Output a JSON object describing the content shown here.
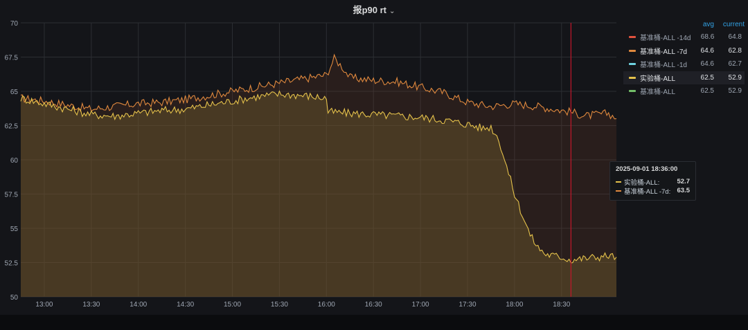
{
  "panel": {
    "title": "报p90 rt"
  },
  "tooltip": {
    "time": "2025-09-01 18:36:00",
    "rows": [
      {
        "name": "实验桶-ALL:",
        "value": "52.7",
        "color": "#e5c24b"
      },
      {
        "name": "基准桶-ALL -7d:",
        "value": "63.5",
        "color": "#e0893e"
      }
    ]
  },
  "legend": {
    "avg_header": "avg",
    "current_header": "current",
    "items": [
      {
        "name": "基准桶-ALL -14d",
        "avg": "68.6",
        "current": "64.8",
        "color": "#e0523e",
        "bold": false
      },
      {
        "name": "基准桶-ALL -7d",
        "avg": "64.6",
        "current": "62.8",
        "color": "#e0893e",
        "bold": true
      },
      {
        "name": "基准桶-ALL -1d",
        "avg": "64.6",
        "current": "62.7",
        "color": "#6fd3e0",
        "bold": false
      },
      {
        "name": "实验桶-ALL",
        "avg": "62.5",
        "current": "52.9",
        "color": "#e5c24b",
        "bold": true
      },
      {
        "name": "基准桶-ALL",
        "avg": "62.5",
        "current": "52.9",
        "color": "#73bf69",
        "bold": false
      }
    ]
  },
  "chart_data": {
    "type": "line",
    "title": "报p90 rt",
    "ylim": [
      50,
      70
    ],
    "yticks": [
      "50",
      "52.5",
      "55",
      "57.5",
      "60",
      "62.5",
      "65",
      "67.5",
      "70"
    ],
    "xlim": [
      "12:45",
      "19:05"
    ],
    "xticks": [
      "13:00",
      "13:30",
      "14:00",
      "14:30",
      "15:00",
      "15:30",
      "16:00",
      "16:30",
      "17:00",
      "17:30",
      "18:00",
      "18:30"
    ],
    "grid": true,
    "legend_position": "right",
    "cursor_time": "18:36",
    "series": [
      {
        "name": "基准桶-ALL -7d",
        "color": "#e0893e",
        "x": [
          "12:45",
          "13:00",
          "13:15",
          "13:30",
          "13:45",
          "14:00",
          "14:15",
          "14:30",
          "14:45",
          "15:00",
          "15:15",
          "15:30",
          "15:45",
          "16:00",
          "16:05",
          "16:10",
          "16:15",
          "16:30",
          "16:45",
          "17:00",
          "17:15",
          "17:30",
          "17:45",
          "18:00",
          "18:15",
          "18:30",
          "18:36",
          "18:45",
          "19:00",
          "19:05"
        ],
        "y": [
          64.5,
          64.3,
          64.0,
          63.7,
          63.9,
          64.1,
          64.2,
          64.4,
          64.7,
          65.0,
          65.3,
          65.6,
          65.9,
          66.2,
          67.4,
          66.8,
          66.0,
          65.8,
          65.7,
          65.3,
          64.9,
          64.2,
          63.9,
          64.1,
          63.9,
          63.6,
          63.5,
          63.2,
          63.4,
          63.0
        ]
      },
      {
        "name": "实验桶-ALL",
        "color": "#e5c24b",
        "x": [
          "12:45",
          "13:00",
          "13:15",
          "13:30",
          "13:45",
          "14:00",
          "14:15",
          "14:30",
          "14:45",
          "15:00",
          "15:15",
          "15:30",
          "15:45",
          "16:00",
          "16:01",
          "16:15",
          "16:30",
          "16:45",
          "17:00",
          "17:15",
          "17:30",
          "17:40",
          "17:45",
          "17:50",
          "17:55",
          "18:00",
          "18:05",
          "18:10",
          "18:15",
          "18:20",
          "18:30",
          "18:36",
          "18:45",
          "19:00",
          "19:05"
        ],
        "y": [
          64.5,
          64.1,
          63.7,
          63.3,
          63.2,
          63.4,
          63.6,
          63.7,
          64.0,
          64.3,
          64.6,
          64.8,
          64.7,
          64.5,
          63.5,
          63.4,
          63.3,
          63.2,
          63.1,
          62.9,
          62.6,
          62.3,
          62.4,
          61.5,
          59.5,
          57.5,
          56.0,
          54.5,
          53.6,
          53.1,
          52.9,
          52.7,
          52.8,
          53.0,
          52.9
        ]
      }
    ]
  }
}
